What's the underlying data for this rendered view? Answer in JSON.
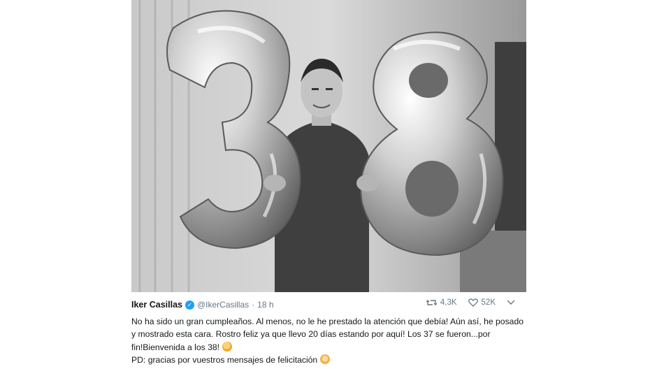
{
  "tweet": {
    "photo_subject": "balloons-38",
    "balloon_numbers": [
      "3",
      "8"
    ],
    "author_name": "Iker Casillas",
    "handle": "@IkerCasillas",
    "separator": "·",
    "time": "18 h",
    "verified_icon": "verified-badge-icon",
    "retweet_count": "4,3K",
    "like_count": "52K",
    "text_main": "No ha sido un gran cumpleaños. Al menos, no le he prestado la atención que debía! Aún así, he posado y mostrado esta cara. Rostro feliz ya que llevo 20 días estando por aquí! Los 37 se fueron...por fin!Bienvenida a los 38!",
    "text_ps": "PD: gracias por vuestros mensajes de felicitación",
    "emoji_1": "clapping-hands-emoji",
    "emoji_2": "ok-hand-emoji"
  },
  "colors": {
    "text": "#14171a",
    "secondary": "#657786",
    "verified": "#1da1f2"
  }
}
